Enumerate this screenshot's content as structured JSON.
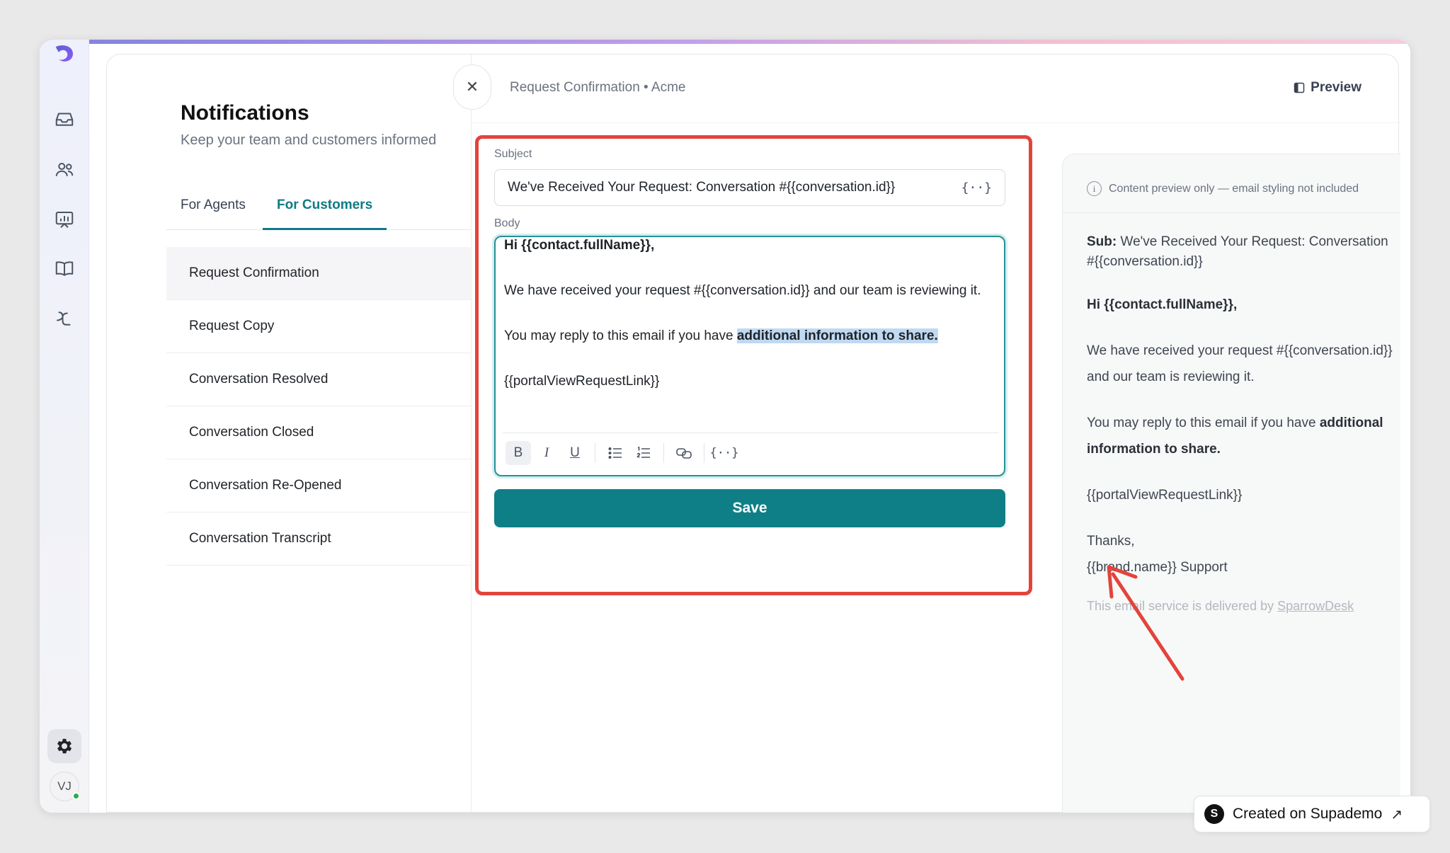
{
  "page": {
    "title": "Notifications",
    "subtitle": "Keep your team and customers informed"
  },
  "tabs": [
    {
      "label": "For Agents",
      "active": false
    },
    {
      "label": "For Customers",
      "active": true
    }
  ],
  "notifications": [
    {
      "label": "Request Confirmation",
      "selected": true
    },
    {
      "label": "Request Copy",
      "selected": false
    },
    {
      "label": "Conversation Resolved",
      "selected": false
    },
    {
      "label": "Conversation Closed",
      "selected": false
    },
    {
      "label": "Conversation Re-Opened",
      "selected": false
    },
    {
      "label": "Conversation Transcript",
      "selected": false
    }
  ],
  "editor": {
    "breadcrumb": "Request Confirmation • Acme",
    "preview_button": "Preview",
    "subject_label": "Subject",
    "subject_value": "We've Received Your Request: Conversation #{{conversation.id}}",
    "body_label": "Body",
    "body": {
      "greeting": "Hi {{contact.fullName}},",
      "line1": "We have received your request #{{conversation.id}} and our team is reviewing it.",
      "line2_prefix": "You may reply to this email if you have ",
      "line2_highlight": "additional information to share.",
      "link_var": "{{portalViewRequestLink}}"
    },
    "toolbar": {
      "bold": "B",
      "italic": "I",
      "underline": "U",
      "variable": "{··}"
    },
    "save_label": "Save"
  },
  "preview": {
    "note": "Content preview only — email styling not included",
    "subject_prefix": "Sub:",
    "subject_text": "We've Received Your Request: Conversation #{{conversation.id}}",
    "greeting": "Hi {{contact.fullName}},",
    "line1": "We have received your request #{{conversation.id}} and our team is reviewing it.",
    "line2_prefix": "You may reply to this email if you have ",
    "line2_bold": "additional information to share.",
    "link_var": "{{portalViewRequestLink}}",
    "thanks": "Thanks,",
    "signature": "{{brand.name}} Support",
    "footer_prefix": "This email service is delivered by ",
    "footer_link": "SparrowDesk"
  },
  "user": {
    "initials": "VJ",
    "status_color": "#2faa4a"
  },
  "badge": {
    "logo_letter": "S",
    "text": "Created on Supademo",
    "ext_icon": "↗"
  },
  "colors": {
    "accent": "#0e7f86",
    "highlight_border": "#e2443b",
    "selection": "#bfd9f2"
  },
  "icons": {
    "sidebar": [
      "logo-icon",
      "inbox-icon",
      "contacts-icon",
      "reports-icon",
      "knowledge-base-icon",
      "automation-icon",
      "settings-icon"
    ]
  }
}
